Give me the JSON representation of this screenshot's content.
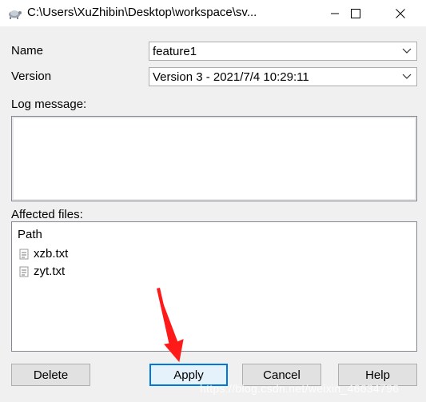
{
  "window": {
    "title": "C:\\Users\\XuZhibin\\Desktop\\workspace\\sv...",
    "app_icon": "tortoise-icon"
  },
  "form": {
    "name_label": "Name",
    "name_value": "feature1",
    "version_label": "Version",
    "version_value": "Version 3 - 2021/7/4 10:29:11",
    "log_label": "Log message:",
    "log_value": "",
    "affected_label": "Affected files:"
  },
  "files": {
    "column_header": "Path",
    "items": [
      {
        "name": "xzb.txt",
        "icon": "text-file-icon"
      },
      {
        "name": "zyt.txt",
        "icon": "text-file-icon"
      }
    ]
  },
  "buttons": {
    "delete": "Delete",
    "apply": "Apply",
    "cancel": "Cancel",
    "help": "Help"
  },
  "annotation": {
    "arrow_color": "#ff1a1a",
    "watermark": "https://blog.csdn.net/weixin_46634796"
  },
  "colors": {
    "focus_border": "#0078d7",
    "dialog_bg": "#f0f0f0"
  }
}
